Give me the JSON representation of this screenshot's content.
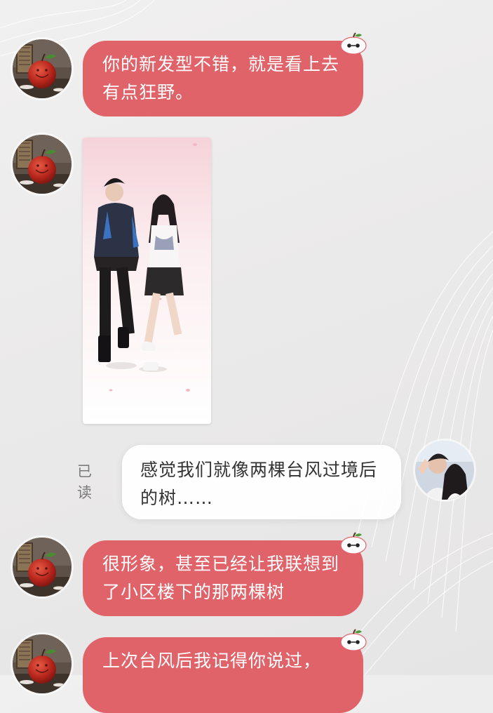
{
  "chat": {
    "messages": [
      {
        "sender": "contact",
        "type": "text",
        "text": "你的新发型不错，就是看上去有点狂野。"
      },
      {
        "sender": "contact",
        "type": "image",
        "image": "couple-3d-illustration"
      },
      {
        "sender": "me",
        "type": "text",
        "text": "感觉我们就像两棵台风过境后的树……",
        "status": "已读"
      },
      {
        "sender": "contact",
        "type": "text",
        "text": "很形象，甚至已经让我联想到了小区楼下的那两棵树"
      },
      {
        "sender": "contact",
        "type": "text",
        "text": "上次台风后我记得你说过，"
      }
    ]
  },
  "ui": {
    "contact_avatar_icon": "apple-avatar-icon",
    "my_avatar_icon": "couple-avatar-icon",
    "bubble_badge_icon": "apple-badge-icon"
  },
  "colors": {
    "incoming_bubble": "#e0636a",
    "incoming_text": "#ffffff",
    "outgoing_bubble": "#ffffff",
    "outgoing_text": "#333333",
    "read_status": "#7a7a7a"
  }
}
